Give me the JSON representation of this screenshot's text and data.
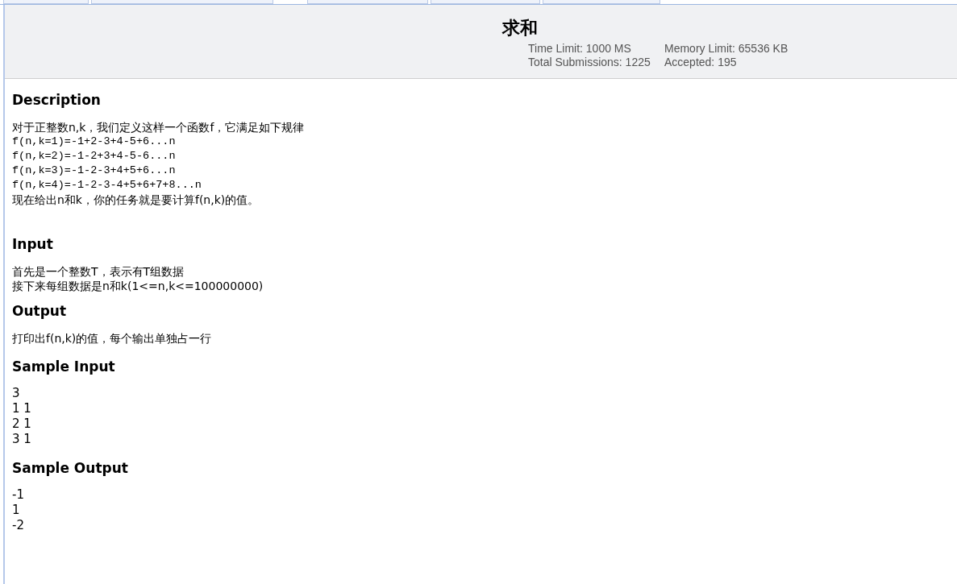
{
  "title": "求和",
  "limits": [
    {
      "label": "Time Limit: 1000 MS"
    },
    {
      "label": "Memory Limit: 65536 KB"
    },
    {
      "label": "Total Submissions: 1225"
    },
    {
      "label": "Accepted: 195"
    }
  ],
  "sections": [
    {
      "heading": "Description",
      "kind": "text",
      "lines": [
        {
          "kind": "text",
          "text": "对于正整数n,k，我们定义这样一个函数f，它满足如下规律"
        },
        {
          "kind": "code",
          "text": "f(n,k=1)=-1+2-3+4-5+6...n"
        },
        {
          "kind": "code",
          "text": "f(n,k=2)=-1-2+3+4-5-6...n"
        },
        {
          "kind": "code",
          "text": "f(n,k=3)=-1-2-3+4+5+6...n"
        },
        {
          "kind": "code",
          "text": "f(n,k=4)=-1-2-3-4+5+6+7+8...n"
        },
        {
          "kind": "text",
          "text": "现在给出n和k，你的任务就是要计算f(n,k)的值。"
        }
      ]
    },
    {
      "heading": "Input",
      "kind": "text",
      "lines": [
        {
          "kind": "text",
          "text": "首先是一个整数T，表示有T组数据"
        },
        {
          "kind": "text",
          "text": "接下来每组数据是n和k(1<=n,k<=100000000)"
        }
      ]
    },
    {
      "heading": "Output",
      "kind": "text",
      "lines": [
        {
          "kind": "text",
          "text": "打印出f(n,k)的值，每个输出单独占一行"
        }
      ]
    },
    {
      "heading": "Sample Input",
      "kind": "sample",
      "lines": [
        {
          "kind": "text",
          "text": "3"
        },
        {
          "kind": "text",
          "text": "1 1"
        },
        {
          "kind": "text",
          "text": "2 1"
        },
        {
          "kind": "text",
          "text": "3 1"
        }
      ]
    },
    {
      "heading": "Sample Output",
      "kind": "sample",
      "lines": [
        {
          "kind": "text",
          "text": "-1"
        },
        {
          "kind": "text",
          "text": "1"
        },
        {
          "kind": "text",
          "text": "-2"
        }
      ]
    }
  ]
}
